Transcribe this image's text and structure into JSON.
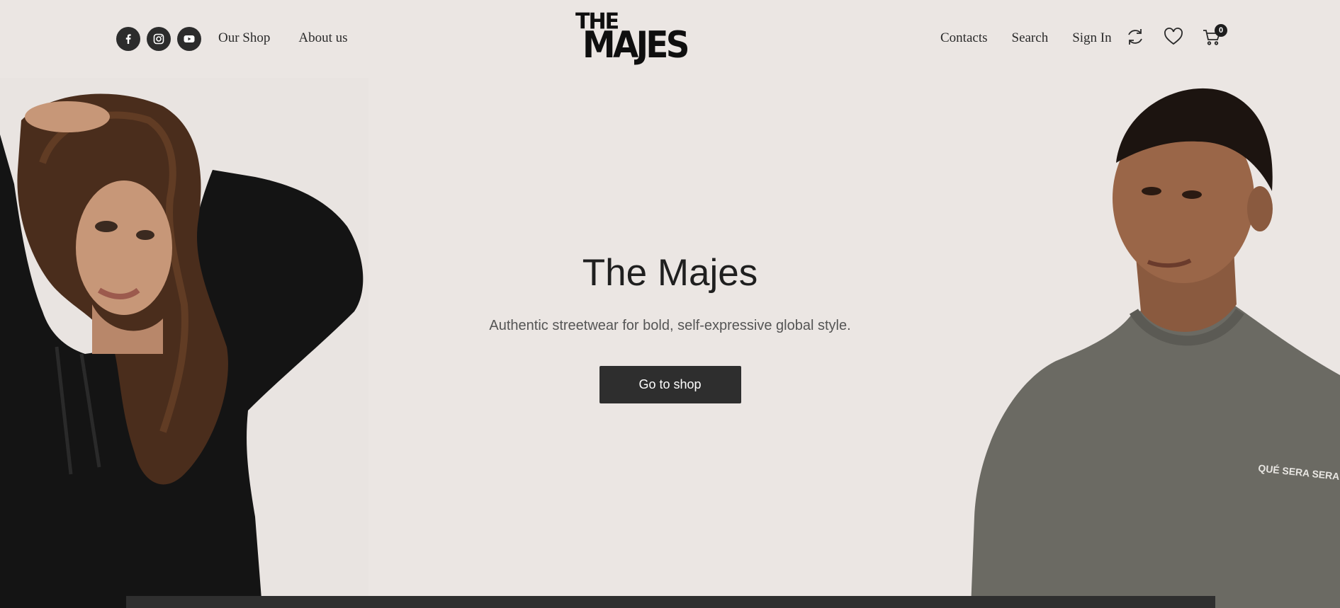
{
  "brand": {
    "logo_top": "THE",
    "logo_bottom": "MAJES"
  },
  "nav": {
    "left": [
      "Our Shop",
      "About us"
    ],
    "right": [
      "Contacts",
      "Search",
      "Sign In"
    ]
  },
  "socials": [
    "facebook-icon",
    "instagram-icon",
    "youtube-icon"
  ],
  "header_icons": [
    "compare-icon",
    "heart-icon",
    "cart-icon"
  ],
  "cart": {
    "count": "0"
  },
  "hero": {
    "title": "The Majes",
    "subtitle": "Authentic streetwear for bold, self-expressive global style.",
    "cta_label": "Go to shop",
    "shirt_print": "QUÉ SERA SERA"
  },
  "colors": {
    "background": "#ebe6e3",
    "button": "#2e2e2e",
    "text": "#1f1f1f"
  }
}
